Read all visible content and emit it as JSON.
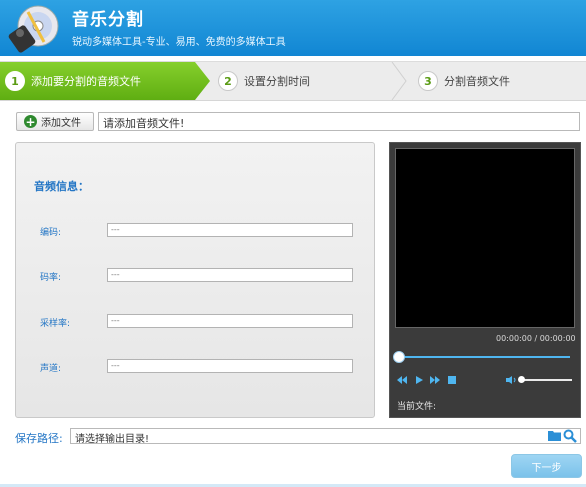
{
  "app": {
    "title": "音乐分割",
    "subtitle": "锐动多媒体工具-专业、易用、免费的多媒体工具"
  },
  "steps": [
    {
      "num": "1",
      "label": "添加要分割的音频文件",
      "active": true
    },
    {
      "num": "2",
      "label": "设置分割时间",
      "active": false
    },
    {
      "num": "3",
      "label": "分割音频文件",
      "active": false
    }
  ],
  "toolbar": {
    "add_file_label": "添加文件",
    "file_input_value": "请添加音频文件!"
  },
  "info": {
    "title": "音频信息：",
    "fields": [
      {
        "label": "编码:",
        "value": "---"
      },
      {
        "label": "码率:",
        "value": "---"
      },
      {
        "label": "采样率:",
        "value": "---"
      },
      {
        "label": "声道:",
        "value": "---"
      }
    ]
  },
  "player": {
    "time": "00:00:00 / 00:00:00",
    "current_file_label": "当前文件:",
    "seek_position": 0,
    "volume_level": 0
  },
  "output": {
    "save_label": "保存路径:",
    "save_input_value": "请选择输出目录!"
  },
  "footer": {
    "next_label": "下一步"
  },
  "colors": {
    "header": "#1a8fd9",
    "active_step": "#6cba19",
    "label_blue": "#2476c5",
    "player_bg": "#3b3b3b"
  }
}
